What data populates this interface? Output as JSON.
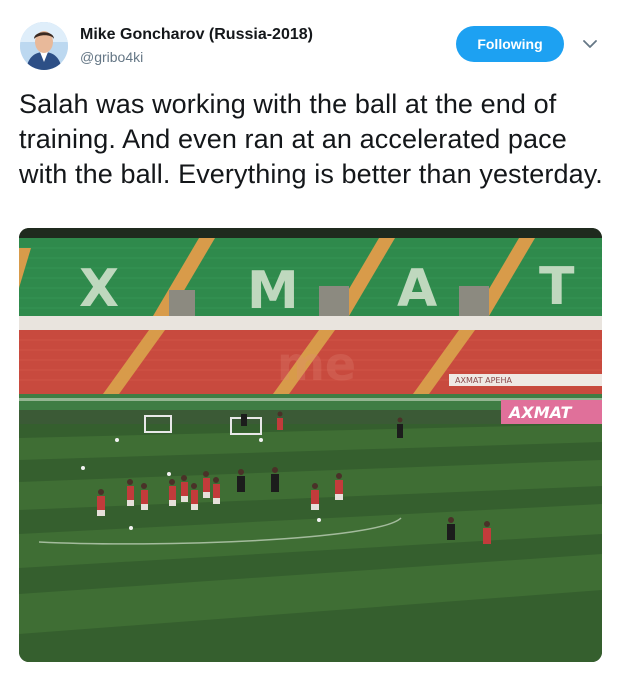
{
  "author": {
    "display_name": "Mike Goncharov (Russia-2018)",
    "handle": "@gribo4ki"
  },
  "actions": {
    "follow_label": "Following"
  },
  "tweet": {
    "text": "Salah was working with the ball at the end of training. And even ran at an accelerated pace with the ball. Everything is better than yesterday."
  },
  "media": {
    "stand_letters": [
      "X",
      "M",
      "A",
      "T"
    ],
    "board_label": "AXMAT",
    "ad_text": "AXMAT APEHA",
    "colors": {
      "seats_green": "#2f8a4c",
      "seats_red": "#c84a3e",
      "pitch_light": "#3f6e34",
      "pitch_dark": "#2e5728",
      "board_pink": "#e0709a"
    }
  },
  "icons": {
    "caret": "chevron-down-icon",
    "avatar": "avatar"
  }
}
